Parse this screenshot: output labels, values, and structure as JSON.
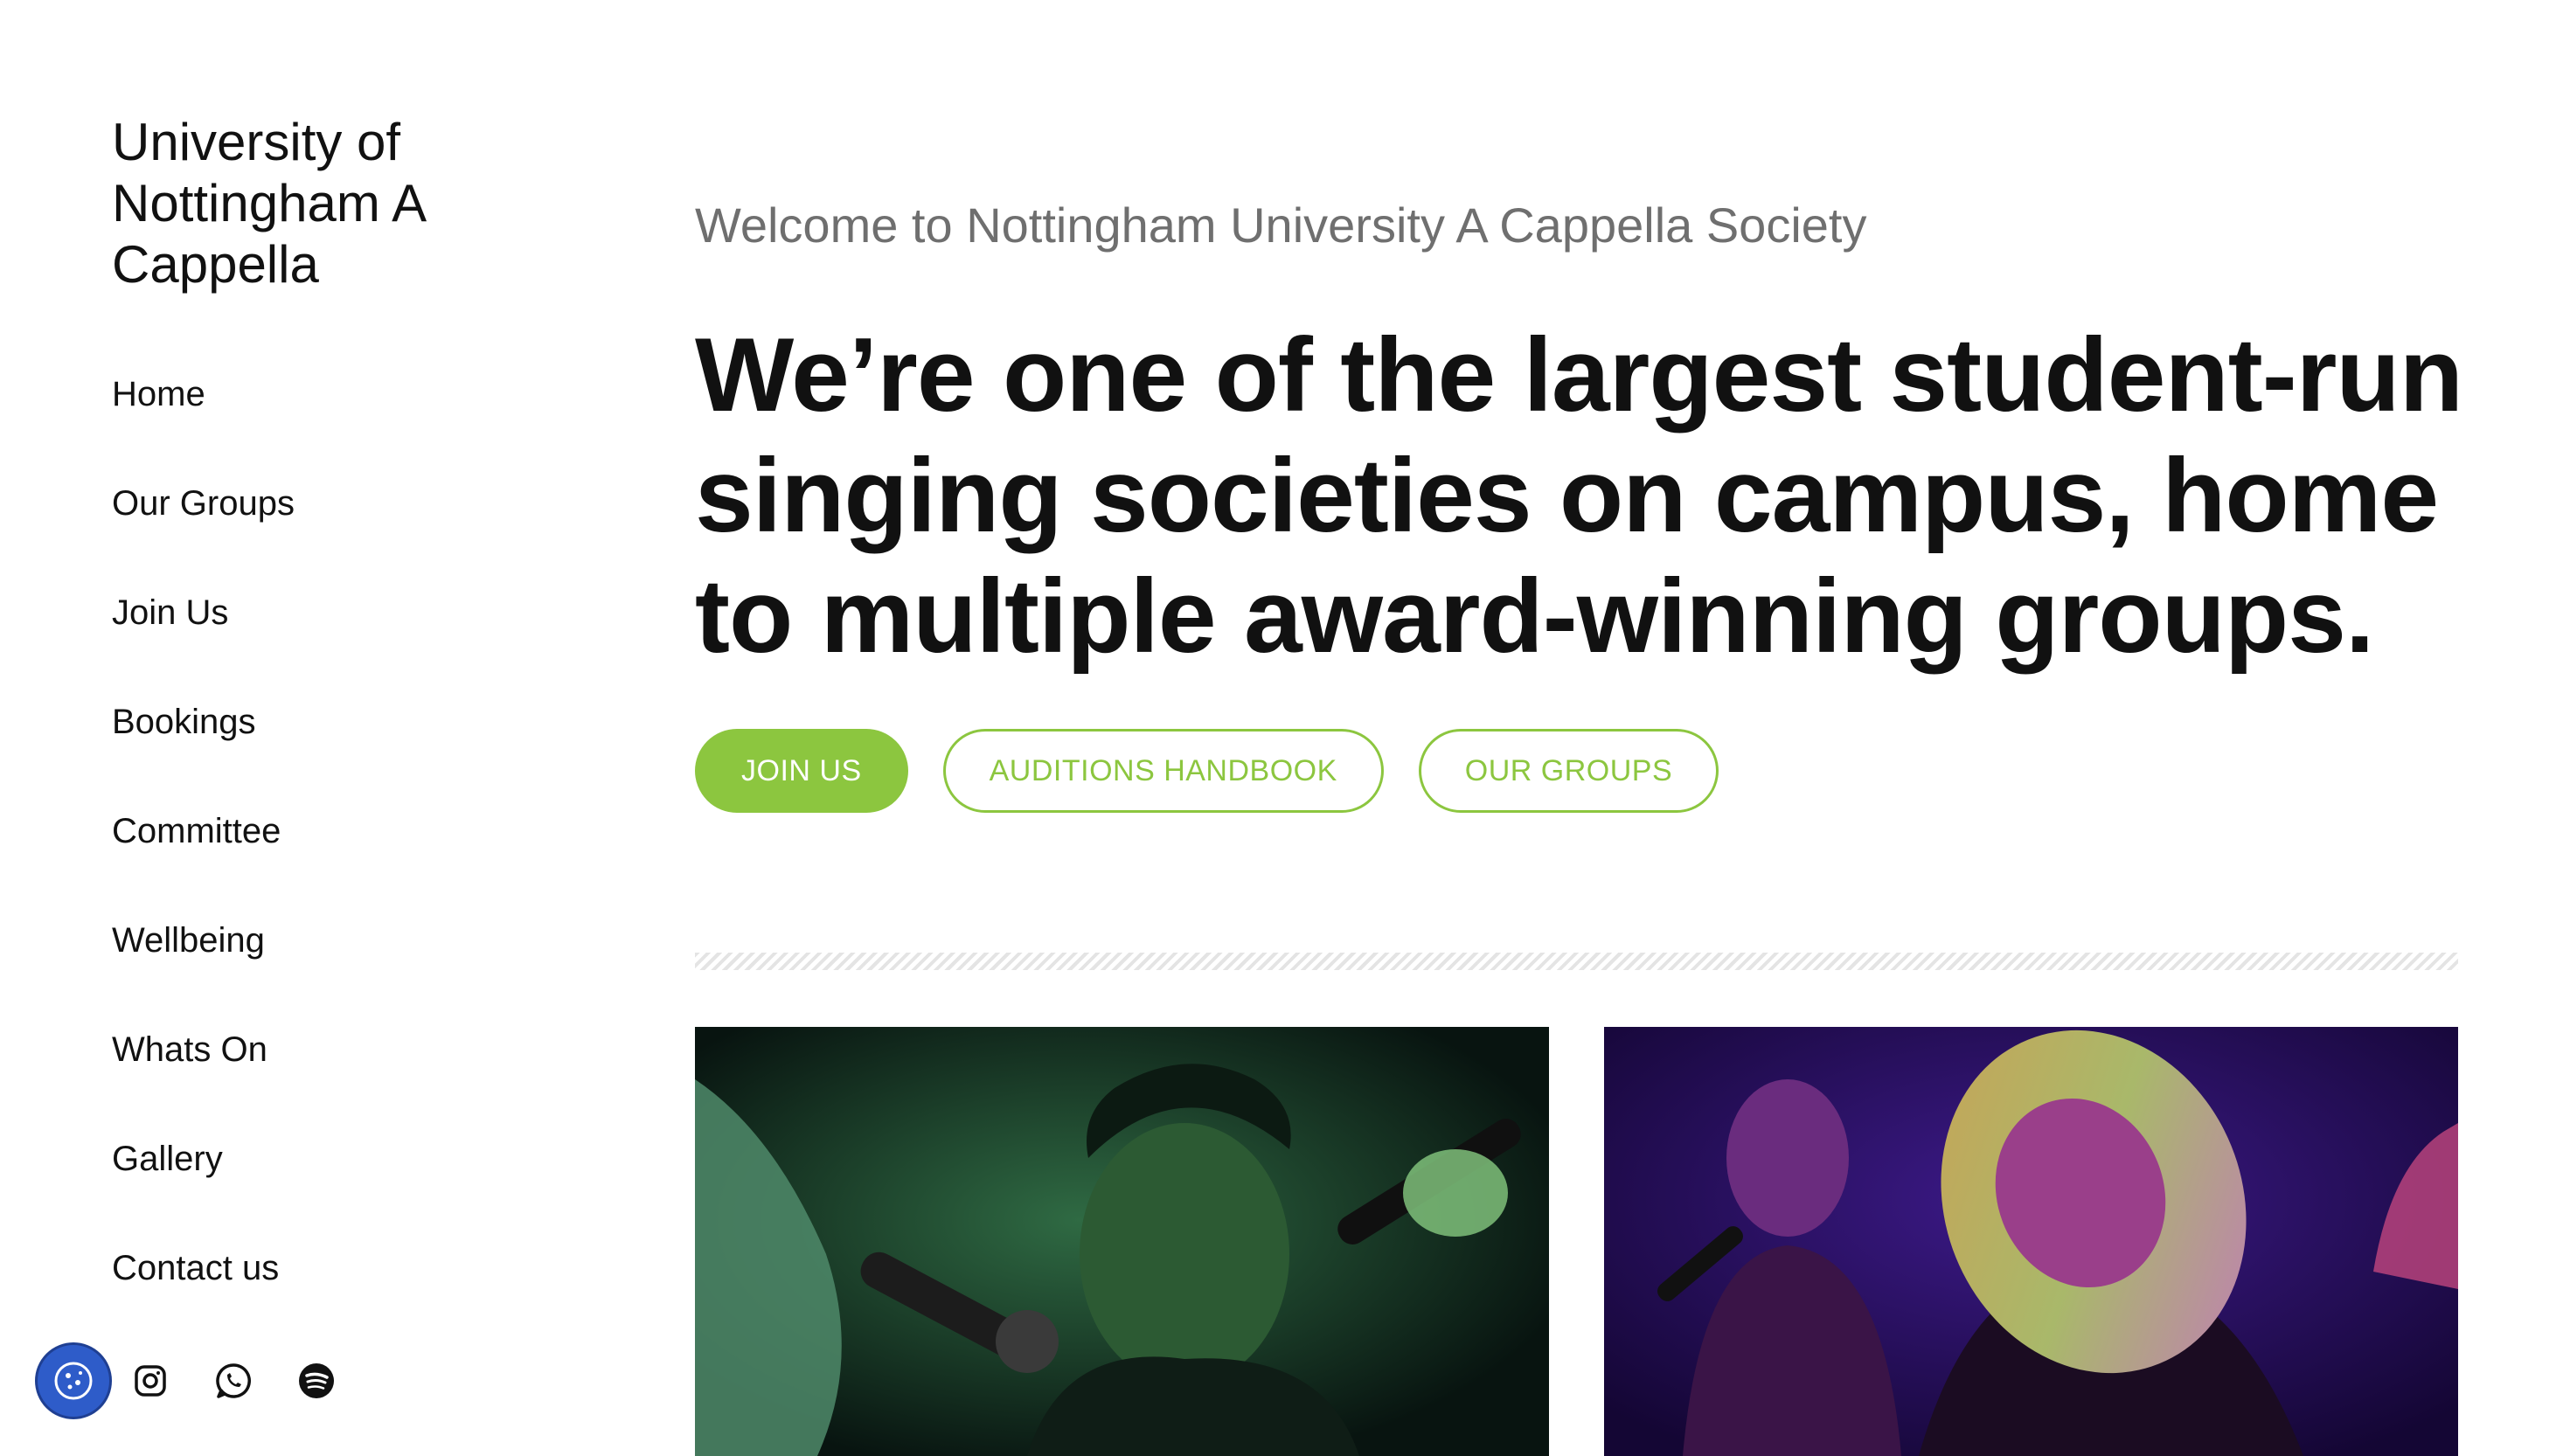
{
  "site": {
    "title": "University of Nottingham A Cappella"
  },
  "nav": {
    "items": [
      {
        "label": "Home"
      },
      {
        "label": "Our Groups"
      },
      {
        "label": "Join Us"
      },
      {
        "label": "Bookings"
      },
      {
        "label": "Committee"
      },
      {
        "label": "Wellbeing"
      },
      {
        "label": "Whats On"
      },
      {
        "label": "Gallery"
      },
      {
        "label": "Contact us"
      }
    ]
  },
  "socials": {
    "icons": [
      "cookie-icon",
      "instagram-icon",
      "whatsapp-icon",
      "spotify-icon"
    ]
  },
  "hero": {
    "welcome": "Welcome to Nottingham University A Cappella Society",
    "headline": "We’re one of the largest student-run singing societies on campus, home to multiple award-winning groups.",
    "buttons": {
      "join": "JOIN US",
      "handbook": "AUDITIONS HANDBOOK",
      "groups": "OUR GROUPS"
    }
  },
  "colors": {
    "accent": "#8cc63f",
    "cookie": "#2e5cc9",
    "welcome_text": "#6f6f6f"
  }
}
